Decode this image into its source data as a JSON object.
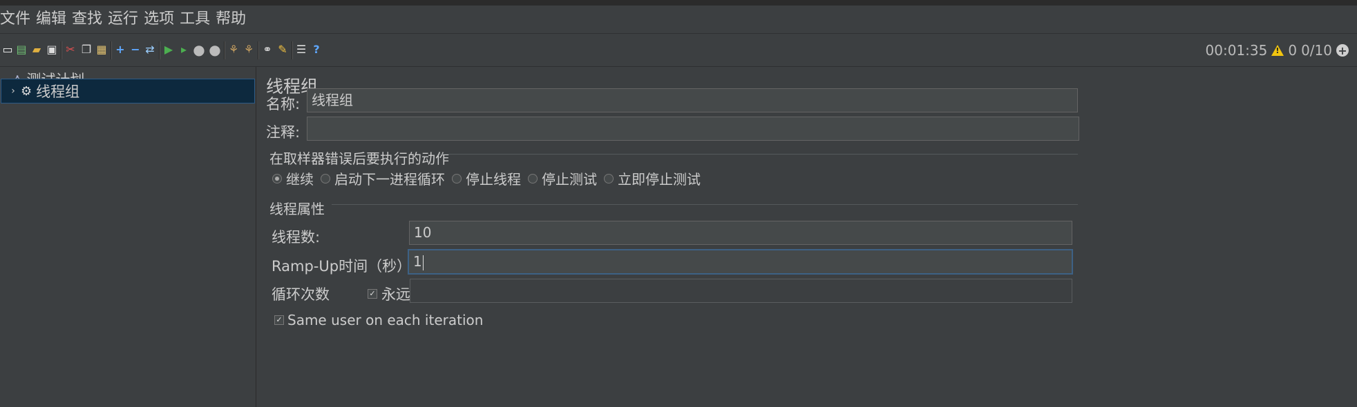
{
  "menu": [
    "文件",
    "编辑",
    "查找",
    "运行",
    "选项",
    "工具",
    "帮助"
  ],
  "toolbar_icons": [
    "new-icon",
    "templates-icon",
    "open-icon",
    "save-icon",
    "cut-icon",
    "copy-icon",
    "paste-icon",
    "expand-icon",
    "collapse-icon",
    "toggle-icon",
    "start-icon",
    "start-no-pause-icon",
    "stop-icon",
    "shutdown-icon",
    "clear-icon",
    "clear-all-icon",
    "search-icon",
    "reset-search-icon",
    "function-helper-icon",
    "help-icon"
  ],
  "status": {
    "elapsed": "00:01:35",
    "warnings": "0",
    "threads": "0/10"
  },
  "tree": {
    "root": "测试计划",
    "child": "线程组"
  },
  "form": {
    "title": "线程组",
    "name_label": "名称:",
    "name_value": "线程组",
    "comment_label": "注释:",
    "comment_value": "",
    "error_group_title": "在取样器错误后要执行的动作",
    "error_options": [
      "继续",
      "启动下一进程循环",
      "停止线程",
      "停止测试",
      "立即停止测试"
    ],
    "error_selected": 0,
    "thread_group_title": "线程属性",
    "threads_label": "线程数:",
    "threads_value": "10",
    "rampup_label": "Ramp-Up时间（秒）:",
    "rampup_value": "1",
    "loop_label": "循环次数",
    "forever_label": "永远",
    "forever_checked": true,
    "loop_value": "",
    "same_user_label": "Same user on each iteration",
    "same_user_checked": true
  },
  "colors": {
    "background": "#3c3f41",
    "selected_row": "#0d293e",
    "input_bg": "#45494a",
    "focus_border": "#3d6185",
    "warning": "#f1c40f"
  }
}
